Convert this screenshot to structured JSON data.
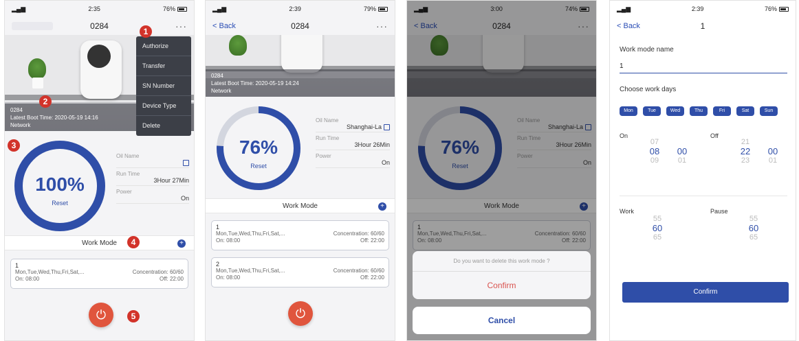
{
  "status": {
    "time1": "2:35",
    "time2": "2:39",
    "time3": "3:00",
    "time4": "2:39",
    "battery1": "76%",
    "battery2": "79%",
    "battery3": "74%",
    "battery4": "76%"
  },
  "panel1": {
    "device_title": "0284",
    "menu": [
      "Authorize",
      "Transfer",
      "SN Number",
      "Device Type",
      "Delete"
    ],
    "hero_lines": [
      "0284",
      "Latest Boot Time: 2020-05-19 14:16",
      "Network"
    ],
    "percent": "100%",
    "reset": "Reset",
    "oil_name_label": "Oil Name",
    "oil_name_value": "",
    "run_time_label": "Run Time",
    "run_time_value": "3Hour 27Min",
    "power_label": "Power",
    "power_value": "On",
    "work_mode": "Work Mode",
    "cards": [
      {
        "num": "1",
        "days": "Mon,Tue,Wed,Thu,Fri,Sat,...",
        "conc": "Concentration: 60/60",
        "on": "On: 08:00",
        "off": "Off: 22:00"
      }
    ],
    "badges": [
      "1",
      "2",
      "3",
      "4",
      "5"
    ]
  },
  "panel2": {
    "back": "< Back",
    "title": "0284",
    "hero_lines": [
      "0284",
      "Latest Boot Time: 2020-05-19 14:24",
      "Network"
    ],
    "percent": "76%",
    "reset": "Reset",
    "oil_name_label": "Oil Name",
    "oil_name_value": "Shanghai-La",
    "run_time_label": "Run Time",
    "run_time_value": "3Hour 26Min",
    "power_label": "Power",
    "power_value": "On",
    "work_mode": "Work Mode",
    "cards": [
      {
        "num": "1",
        "days": "Mon,Tue,Wed,Thu,Fri,Sat,...",
        "conc": "Concentration: 60/60",
        "on": "On: 08:00",
        "off": "Off: 22:00"
      },
      {
        "num": "2",
        "days": "Mon,Tue,Wed,Thu,Fri,Sat,...",
        "conc": "Concentration: 60/60",
        "on": "On: 08:00",
        "off": "Off: 22:00"
      }
    ]
  },
  "panel3": {
    "back": "< Back",
    "title": "0284",
    "percent": "76%",
    "reset": "Reset",
    "oil_name_label": "Oil Name",
    "oil_name_value": "Shanghai-La",
    "run_time_label": "Run Time",
    "run_time_value": "3Hour 26Min",
    "power_label": "Power",
    "power_value": "On",
    "work_mode": "Work Mode",
    "card": {
      "num": "1",
      "days": "Mon,Tue,Wed,Thu,Fri,Sat,...",
      "conc": "Concentration: 60/60",
      "on": "On: 08:00",
      "off": "Off: 22:00"
    },
    "question": "Do you want to delete this work mode ?",
    "confirm": "Confirm",
    "cancel": "Cancel"
  },
  "panel4": {
    "back": "< Back",
    "title": "1",
    "name_label": "Work mode name",
    "name_value": "1",
    "days_label": "Choose work days",
    "days": [
      "Mon",
      "Tue",
      "Wed",
      "Thu",
      "Fri",
      "Sat",
      "Sun"
    ],
    "on_label": "On",
    "off_label": "Off",
    "on_hour": [
      "07",
      "08",
      "09"
    ],
    "on_min": [
      "",
      "00",
      "01"
    ],
    "off_hour": [
      "21",
      "22",
      "23"
    ],
    "off_min": [
      "",
      "00",
      "01"
    ],
    "work_label": "Work",
    "pause_label": "Pause",
    "work_vals": [
      "55",
      "60",
      "65"
    ],
    "pause_vals": [
      "55",
      "60",
      "65"
    ],
    "confirm": "Confirm"
  },
  "colors": {
    "accent": "#2f4ea8",
    "power": "#e0553d",
    "badge": "#d2332a",
    "danger": "#d9534f"
  }
}
